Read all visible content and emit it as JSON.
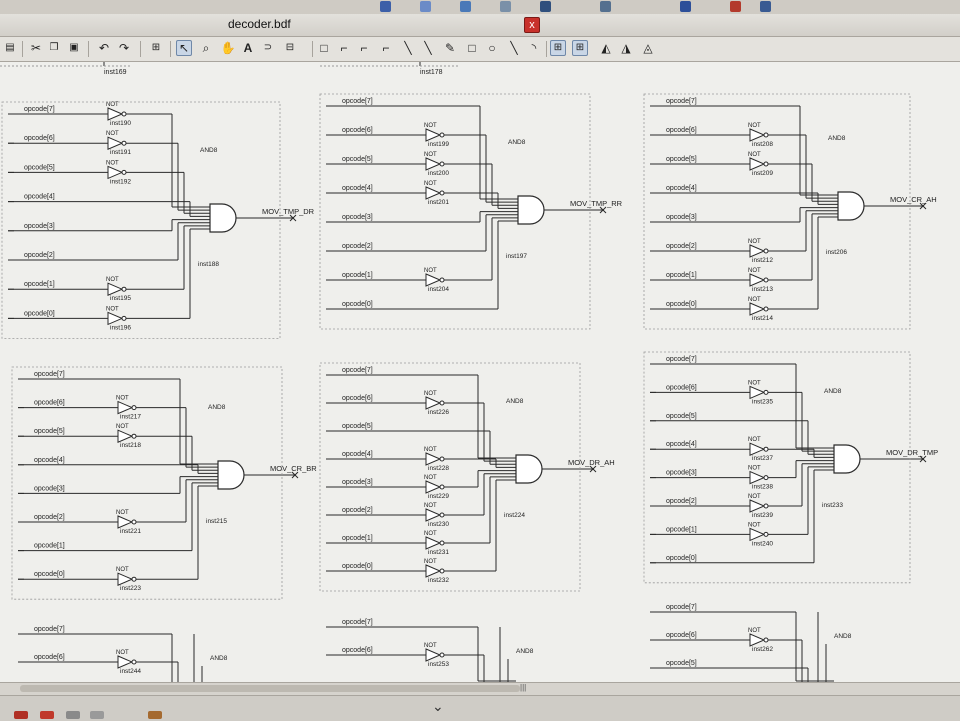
{
  "window": {
    "title": "decoder.bdf",
    "close_glyph": "x"
  },
  "toolbar": {
    "icons": [
      "print-icon",
      "cut-icon",
      "copy-icon",
      "paste-icon",
      "undo-icon",
      "redo-icon",
      "block-icon",
      "selection-tool-icon",
      "zoom-icon",
      "hand-icon",
      "text-icon",
      "symbol-icon",
      "block-tool-icon",
      "pin-icon",
      "orthogonal-node-icon",
      "orthogonal-bus-icon",
      "conduit-icon",
      "diagonal-node-icon",
      "diagonal-bus-icon",
      "pencil-icon",
      "rectangle-icon",
      "ellipse-icon",
      "line-icon",
      "arc-icon",
      "rubberbanding-icon",
      "partial-line-icon",
      "flip-horizontal-icon",
      "flip-vertical-icon",
      "rotate-icon"
    ],
    "glyphs": {
      "cut": "✂",
      "undo": "↶",
      "redo": "↷",
      "select": "↖",
      "zoom": "⌕",
      "hand": "✋",
      "text": "A",
      "rectangle": "□",
      "ellipse": "○"
    }
  },
  "schematic": {
    "top_partial_labels": [
      "inst169",
      "inst178"
    ],
    "blocks": [
      {
        "id": "b1",
        "gate": "AND8",
        "inst": "inst188",
        "output": "MOV_TMP_DR",
        "inputs": [
          "opcode[7]",
          "opcode[6]",
          "opcode[5]",
          "opcode[4]",
          "opcode[3]",
          "opcode[2]",
          "opcode[1]",
          "opcode[0]"
        ],
        "nots": [
          [
            "NOT",
            "inst190"
          ],
          [
            "NOT",
            "inst191"
          ],
          [
            "NOT",
            "inst192"
          ],
          null,
          null,
          null,
          [
            "NOT",
            "inst195"
          ],
          [
            "NOT",
            "inst196"
          ]
        ]
      },
      {
        "id": "b2",
        "gate": "AND8",
        "inst": "inst197",
        "output": "MOV_TMP_RR",
        "inputs": [
          "opcode[7]",
          "opcode[6]",
          "opcode[5]",
          "opcode[4]",
          "opcode[3]",
          "opcode[2]",
          "opcode[1]",
          "opcode[0]"
        ],
        "nots": [
          null,
          [
            "NOT",
            "inst199"
          ],
          [
            "NOT",
            "inst200"
          ],
          [
            "NOT",
            "inst201"
          ],
          null,
          null,
          [
            "NOT",
            "inst204"
          ],
          null
        ]
      },
      {
        "id": "b3",
        "gate": "AND8",
        "inst": "inst206",
        "output": "MOV_CR_AH",
        "inputs": [
          "opcode[7]",
          "opcode[6]",
          "opcode[5]",
          "opcode[4]",
          "opcode[3]",
          "opcode[2]",
          "opcode[1]",
          "opcode[0]"
        ],
        "nots": [
          null,
          [
            "NOT",
            "inst208"
          ],
          [
            "NOT",
            "inst209"
          ],
          null,
          null,
          [
            "NOT",
            "inst212"
          ],
          [
            "NOT",
            "inst213"
          ],
          [
            "NOT",
            "inst214"
          ]
        ]
      },
      {
        "id": "b4",
        "gate": "AND8",
        "inst": "inst215",
        "output": "MOV_CR_BR",
        "inputs": [
          "opcode[7]",
          "opcode[6]",
          "opcode[5]",
          "opcode[4]",
          "opcode[3]",
          "opcode[2]",
          "opcode[1]",
          "opcode[0]"
        ],
        "nots": [
          null,
          [
            "NOT",
            "inst217"
          ],
          [
            "NOT",
            "inst218"
          ],
          null,
          null,
          [
            "NOT",
            "inst221"
          ],
          null,
          [
            "NOT",
            "inst223"
          ]
        ]
      },
      {
        "id": "b5",
        "gate": "AND8",
        "inst": "inst224",
        "output": "MOV_DR_AH",
        "inputs": [
          "opcode[7]",
          "opcode[6]",
          "opcode[5]",
          "opcode[4]",
          "opcode[3]",
          "opcode[2]",
          "opcode[1]",
          "opcode[0]"
        ],
        "nots": [
          null,
          [
            "NOT",
            "inst226"
          ],
          null,
          [
            "NOT",
            "inst228"
          ],
          [
            "NOT",
            "inst229"
          ],
          [
            "NOT",
            "inst230"
          ],
          [
            "NOT",
            "inst231"
          ],
          [
            "NOT",
            "inst232"
          ]
        ]
      },
      {
        "id": "b6",
        "gate": "AND8",
        "inst": "inst233",
        "output": "MOV_DR_TMP",
        "inputs": [
          "opcode[7]",
          "opcode[6]",
          "opcode[5]",
          "opcode[4]",
          "opcode[3]",
          "opcode[2]",
          "opcode[1]",
          "opcode[0]"
        ],
        "nots": [
          null,
          [
            "NOT",
            "inst235"
          ],
          null,
          [
            "NOT",
            "inst237"
          ],
          [
            "NOT",
            "inst238"
          ],
          [
            "NOT",
            "inst239"
          ],
          [
            "NOT",
            "inst240"
          ],
          null
        ]
      },
      {
        "id": "b7",
        "gate": "AND8",
        "inst": "",
        "output": "",
        "inputs": [
          "opcode[7]",
          "opcode[6]"
        ],
        "nots": [
          null,
          [
            "NOT",
            "inst244"
          ]
        ]
      },
      {
        "id": "b8",
        "gate": "AND8",
        "inst": "",
        "output": "",
        "inputs": [
          "opcode[7]",
          "opcode[6]"
        ],
        "nots": [
          null,
          [
            "NOT",
            "inst253"
          ]
        ]
      },
      {
        "id": "b9",
        "gate": "AND8",
        "inst": "",
        "output": "",
        "inputs": [
          "opcode[7]",
          "opcode[6]",
          "opcode[5]"
        ],
        "nots": [
          null,
          [
            "NOT",
            "inst262"
          ],
          null
        ]
      }
    ]
  },
  "statusbar": {
    "chevron": "⌄"
  },
  "colors": {
    "wire": "#2a2a2a",
    "canvas": "#efefec",
    "label": "#222222"
  }
}
